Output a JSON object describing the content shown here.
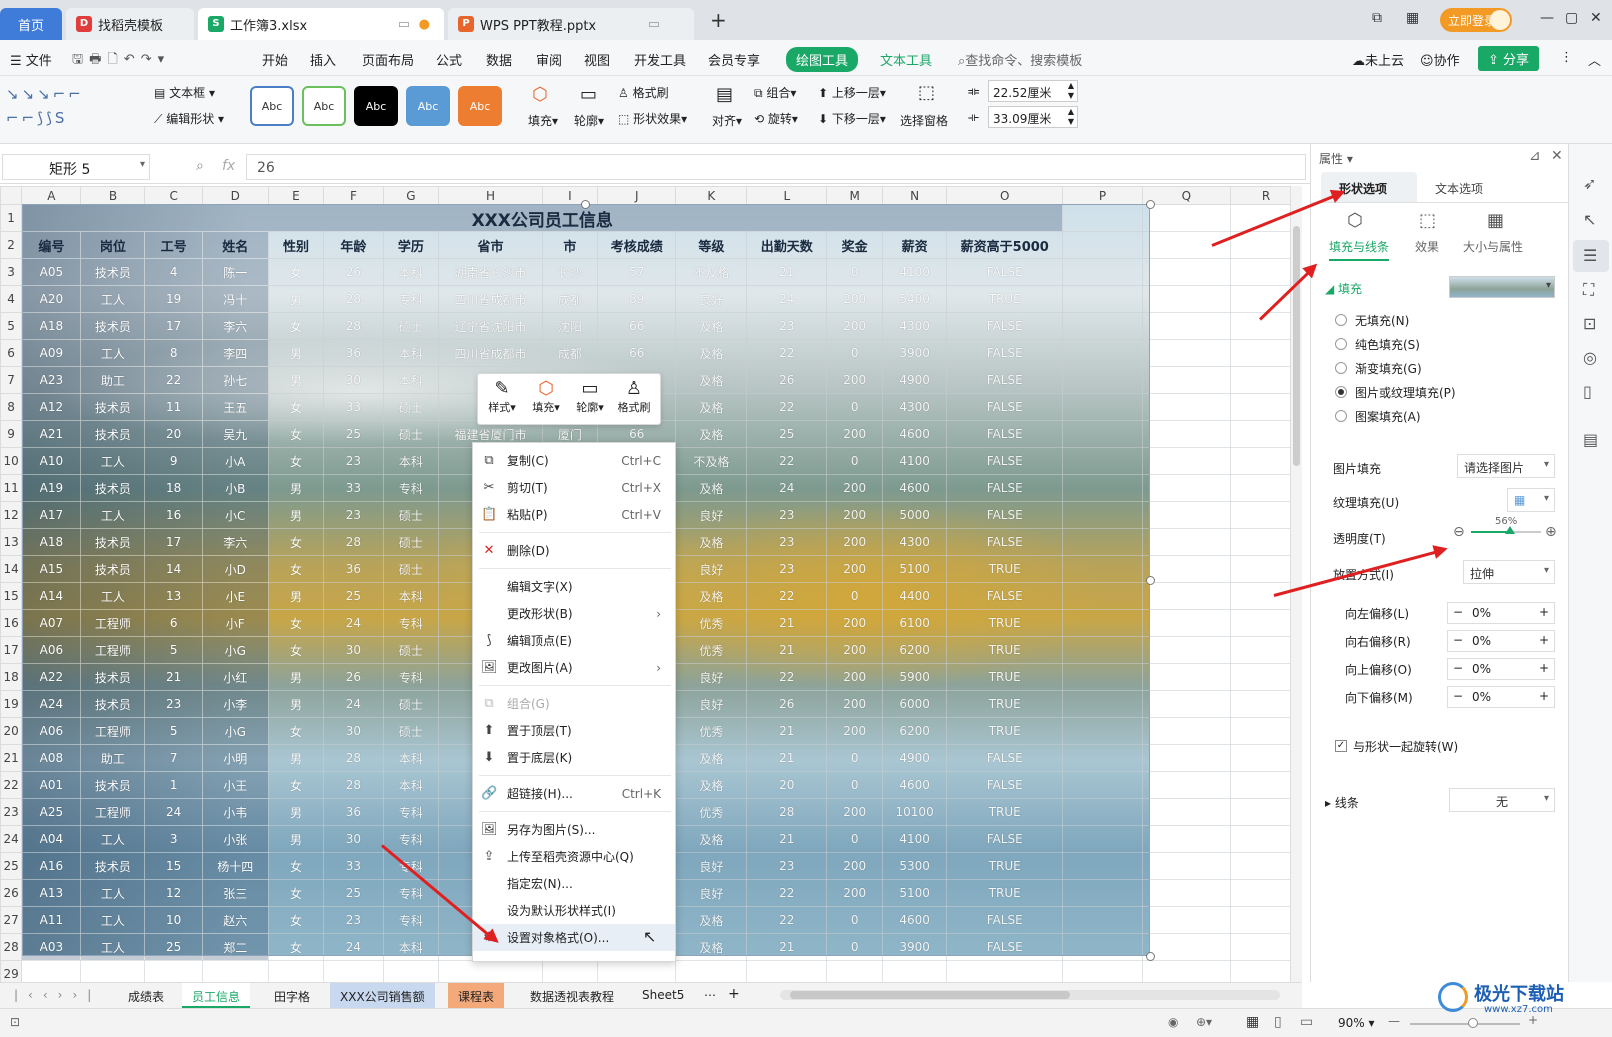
{
  "tabs": [
    {
      "label": "首页"
    },
    {
      "label": "找稻壳模板"
    },
    {
      "label": "工作簿3.xlsx"
    },
    {
      "label": "WPS PPT教程.pptx"
    }
  ],
  "titlebar": {
    "login": "立即登录"
  },
  "menu": {
    "file": "文件",
    "items": [
      "开始",
      "插入",
      "页面布局",
      "公式",
      "数据",
      "审阅",
      "视图",
      "开发工具",
      "会员专享"
    ],
    "draw_tools": "绘图工具",
    "text_tools": "文本工具",
    "search": "查找命令、搜索模板",
    "cloud": "未上云",
    "collab": "协作",
    "share": "分享"
  },
  "ribbon": {
    "textbox": "文本框",
    "edit_shape": "编辑形状",
    "styles": [
      "Abc",
      "Abc",
      "Abc",
      "Abc",
      "Abc"
    ],
    "fill": "填充",
    "outline": "轮廓",
    "format_painter": "格式刷",
    "shape_effect": "形状效果",
    "align": "对齐",
    "group": "组合",
    "rotate": "旋转",
    "up": "上移一层",
    "down": "下移一层",
    "select_pane": "选择窗格",
    "width": "22.52厘米",
    "height": "33.09厘米"
  },
  "formula": {
    "name_box": "矩形 5",
    "fx": "fx",
    "value": "26"
  },
  "columns": [
    "A",
    "B",
    "C",
    "D",
    "E",
    "F",
    "G",
    "H",
    "I",
    "J",
    "K",
    "L",
    "M",
    "N",
    "O",
    "P",
    "Q",
    "R"
  ],
  "sheet": {
    "title": "XXX公司员工信息",
    "headers": [
      "编号",
      "岗位",
      "工号",
      "姓名",
      "性别",
      "年龄",
      "学历",
      "省市",
      "市",
      "考核成绩",
      "等级",
      "出勤天数",
      "奖金",
      "薪资",
      "薪资高于5000"
    ],
    "rows": [
      [
        "A05",
        "技术员",
        "4",
        "陈一",
        "女",
        "26",
        "本科",
        "湖南省长沙市",
        "长沙",
        "57",
        "不及格",
        "21",
        "0",
        "4100",
        "FALSE"
      ],
      [
        "A20",
        "工人",
        "19",
        "冯十",
        "男",
        "28",
        "专科",
        "四川省成都市",
        "成都",
        "89",
        "良好",
        "24",
        "200",
        "5400",
        "TRUE"
      ],
      [
        "A18",
        "技术员",
        "17",
        "李六",
        "女",
        "28",
        "硕士",
        "辽宁省沈阳市",
        "沈阳",
        "66",
        "及格",
        "23",
        "200",
        "4300",
        "FALSE"
      ],
      [
        "A09",
        "工人",
        "8",
        "李四",
        "男",
        "36",
        "本科",
        "四川省成都市",
        "成都",
        "66",
        "及格",
        "22",
        "0",
        "3900",
        "FALSE"
      ],
      [
        "A23",
        "助工",
        "22",
        "孙七",
        "男",
        "30",
        "本科",
        "",
        "",
        "77",
        "及格",
        "26",
        "200",
        "4900",
        "FALSE"
      ],
      [
        "A12",
        "技术员",
        "11",
        "王五",
        "女",
        "33",
        "硕士",
        "",
        "",
        "64",
        "及格",
        "22",
        "0",
        "4300",
        "FALSE"
      ],
      [
        "A21",
        "技术员",
        "20",
        "吴九",
        "女",
        "25",
        "硕士",
        "福建省厦门市",
        "厦门",
        "66",
        "及格",
        "25",
        "200",
        "4600",
        "FALSE"
      ],
      [
        "A10",
        "工人",
        "9",
        "小A",
        "女",
        "23",
        "本科",
        "",
        "",
        "58",
        "不及格",
        "22",
        "0",
        "4100",
        "FALSE"
      ],
      [
        "A19",
        "技术员",
        "18",
        "小B",
        "男",
        "33",
        "专科",
        "",
        "",
        "66",
        "及格",
        "24",
        "200",
        "4600",
        "FALSE"
      ],
      [
        "A17",
        "工人",
        "16",
        "小C",
        "男",
        "23",
        "硕士",
        "",
        "",
        "87",
        "良好",
        "23",
        "200",
        "5000",
        "FALSE"
      ],
      [
        "A18",
        "技术员",
        "17",
        "李六",
        "女",
        "28",
        "硕士",
        "",
        "",
        "66",
        "及格",
        "23",
        "200",
        "4300",
        "FALSE"
      ],
      [
        "A15",
        "技术员",
        "14",
        "小D",
        "女",
        "36",
        "硕士",
        "",
        "",
        "80",
        "良好",
        "23",
        "200",
        "5100",
        "TRUE"
      ],
      [
        "A14",
        "工人",
        "13",
        "小E",
        "男",
        "25",
        "本科",
        "",
        "",
        "79",
        "及格",
        "22",
        "0",
        "4400",
        "FALSE"
      ],
      [
        "A07",
        "工程师",
        "6",
        "小F",
        "女",
        "24",
        "专科",
        "",
        "",
        "90",
        "优秀",
        "21",
        "200",
        "6100",
        "TRUE"
      ],
      [
        "A06",
        "工程师",
        "5",
        "小G",
        "女",
        "30",
        "硕士",
        "",
        "",
        "91",
        "优秀",
        "21",
        "200",
        "6200",
        "TRUE"
      ],
      [
        "A22",
        "技术员",
        "21",
        "小红",
        "男",
        "26",
        "专科",
        "",
        "",
        "87",
        "良好",
        "22",
        "200",
        "5900",
        "TRUE"
      ],
      [
        "A24",
        "技术员",
        "23",
        "小李",
        "男",
        "24",
        "硕士",
        "",
        "",
        "89",
        "良好",
        "26",
        "200",
        "6000",
        "TRUE"
      ],
      [
        "A06",
        "工程师",
        "5",
        "小G",
        "女",
        "30",
        "硕士",
        "",
        "",
        "91",
        "优秀",
        "21",
        "200",
        "6200",
        "TRUE"
      ],
      [
        "A08",
        "助工",
        "7",
        "小明",
        "男",
        "28",
        "本科",
        "",
        "",
        "78",
        "及格",
        "21",
        "0",
        "4900",
        "FALSE"
      ],
      [
        "A01",
        "技术员",
        "1",
        "小王",
        "女",
        "28",
        "本科",
        "",
        "",
        "66",
        "及格",
        "20",
        "0",
        "4600",
        "FALSE"
      ],
      [
        "A25",
        "工程师",
        "24",
        "小韦",
        "男",
        "36",
        "专科",
        "",
        "",
        "95",
        "优秀",
        "28",
        "200",
        "10100",
        "TRUE"
      ],
      [
        "A04",
        "工人",
        "3",
        "小张",
        "男",
        "30",
        "专科",
        "",
        "",
        "64",
        "及格",
        "21",
        "0",
        "4100",
        "FALSE"
      ],
      [
        "A16",
        "技术员",
        "15",
        "杨十四",
        "女",
        "33",
        "专科",
        "",
        "",
        "87",
        "良好",
        "23",
        "200",
        "5300",
        "TRUE"
      ],
      [
        "A13",
        "工人",
        "12",
        "张三",
        "女",
        "25",
        "专科",
        "",
        "",
        "80",
        "良好",
        "22",
        "200",
        "5100",
        "TRUE"
      ],
      [
        "A11",
        "工人",
        "10",
        "赵六",
        "女",
        "23",
        "专科",
        "",
        "",
        "65",
        "及格",
        "22",
        "0",
        "4600",
        "FALSE"
      ],
      [
        "A03",
        "工人",
        "25",
        "郑二",
        "女",
        "24",
        "本科",
        "",
        "",
        "66",
        "及格",
        "21",
        "0",
        "3900",
        "FALSE"
      ]
    ]
  },
  "mini_toolbar": [
    "样式",
    "填充",
    "轮廓",
    "格式刷"
  ],
  "context_menu": {
    "copy": "复制(C)",
    "copy_key": "Ctrl+C",
    "cut": "剪切(T)",
    "cut_key": "Ctrl+X",
    "paste": "粘贴(P)",
    "paste_key": "Ctrl+V",
    "delete": "删除(D)",
    "edit_text": "编辑文字(X)",
    "change_shape": "更改形状(B)",
    "edit_points": "编辑顶点(E)",
    "change_pic": "更改图片(A)",
    "group": "组合(G)",
    "top": "置于顶层(T)",
    "bottom": "置于底层(K)",
    "link": "超链接(H)...",
    "link_key": "Ctrl+K",
    "save_pic": "另存为图片(S)...",
    "upload": "上传至稻壳资源中心(Q)",
    "macro": "指定宏(N)...",
    "default_style": "设为默认形状样式(I)",
    "format_obj": "设置对象格式(O)..."
  },
  "panel": {
    "title": "属性",
    "tab_shape": "形状选项",
    "tab_text": "文本选项",
    "sub": [
      "填充与线条",
      "效果",
      "大小与属性"
    ],
    "fill": "填充",
    "radios": [
      "无填充(N)",
      "纯色填充(S)",
      "渐变填充(G)",
      "图片或纹理填充(P)",
      "图案填充(A)"
    ],
    "pic_fill": "图片填充",
    "pic_fill_val": "请选择图片",
    "texture": "纹理填充(U)",
    "transparency": "透明度(T)",
    "transparency_val": "56%",
    "transparency_level": 0.56,
    "placement": "放置方式(I)",
    "placement_val": "拉伸",
    "offsets": [
      {
        "label": "向左偏移(L)",
        "val": "0%"
      },
      {
        "label": "向右偏移(R)",
        "val": "0%"
      },
      {
        "label": "向上偏移(O)",
        "val": "0%"
      },
      {
        "label": "向下偏移(M)",
        "val": "0%"
      }
    ],
    "rotate_with": "与形状一起旋转(W)",
    "line": "线条",
    "line_val": "无"
  },
  "sheet_tabs": [
    "成绩表",
    "员工信息",
    "田字格",
    "XXX公司销售额",
    "课程表",
    "数据透视表教程",
    "Sheet5"
  ],
  "status": {
    "zoom": "90%",
    "watermark": "极光下载站",
    "watermark_url": "www.xz7.com"
  }
}
